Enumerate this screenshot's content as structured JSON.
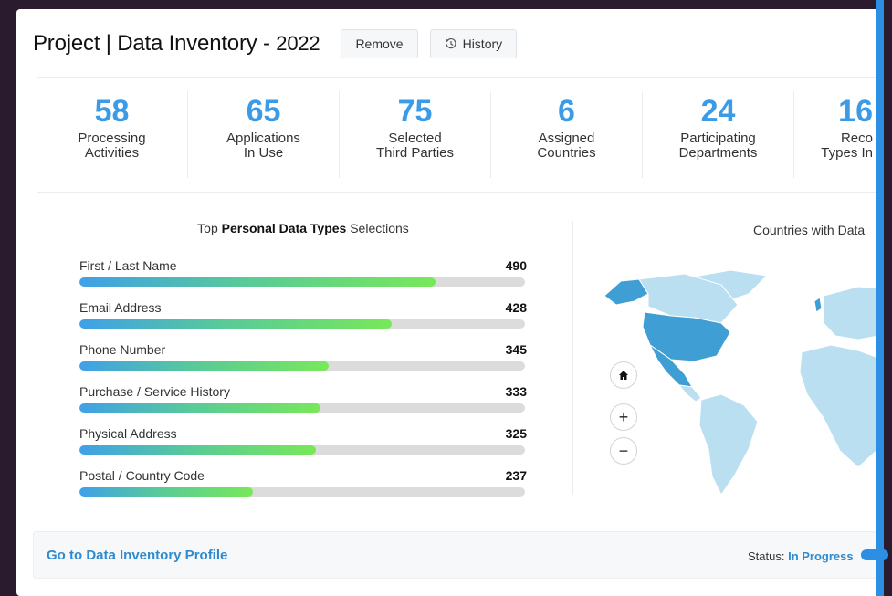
{
  "header": {
    "title": "Project | Data Inventory - ",
    "year": "2022",
    "remove_label": "Remove",
    "history_label": "History",
    "history_icon": "history-icon"
  },
  "stats": [
    {
      "value": "58",
      "line1": "Processing",
      "line2": "Activities"
    },
    {
      "value": "65",
      "line1": "Applications",
      "line2": "In Use"
    },
    {
      "value": "75",
      "line1": "Selected",
      "line2": "Third Parties"
    },
    {
      "value": "6",
      "line1": "Assigned",
      "line2": "Countries"
    },
    {
      "value": "24",
      "line1": "Participating",
      "line2": "Departments"
    },
    {
      "value": "16",
      "line1": "Reco",
      "line2": "Types In"
    }
  ],
  "personal_data": {
    "title_prefix": "Top ",
    "title_bold": "Personal Data Types",
    "title_suffix": " Selections",
    "items": [
      {
        "label": "First / Last Name",
        "value": "490",
        "fill_fraction": 0.8
      },
      {
        "label": "Email Address",
        "value": "428",
        "fill_fraction": 0.7
      },
      {
        "label": "Phone Number",
        "value": "345",
        "fill_fraction": 0.56
      },
      {
        "label": "Purchase / Service History",
        "value": "333",
        "fill_fraction": 0.54
      },
      {
        "label": "Physical Address",
        "value": "325",
        "fill_fraction": 0.53
      },
      {
        "label": "Postal / Country Code",
        "value": "237",
        "fill_fraction": 0.39
      }
    ]
  },
  "map": {
    "title": "Countries with Data",
    "home_icon": "home-icon",
    "zoom_in_label": "+",
    "zoom_out_label": "−",
    "highlight_color": "#3f9fd4",
    "base_color": "#b9dff0"
  },
  "footer": {
    "link_label": "Go to Data Inventory Profile",
    "status_label": "Status: ",
    "status_value": "In Progress"
  }
}
